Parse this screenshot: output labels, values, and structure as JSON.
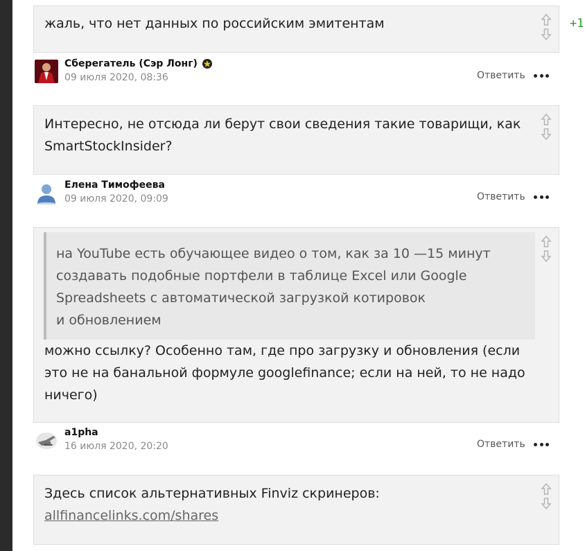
{
  "score": "+1",
  "comments": [
    {
      "text": "жаль, что нет данных по российским эмитентам"
    },
    {
      "text": "Интересно, не отсюда ли берут свои сведения такие товарищи, как SmartStockInsider?"
    },
    {
      "quote": [
        "на YouTube есть обучающее видео о том, как за 10 —15 минут",
        "создавать подобные портфели в таблице Excel или Google",
        "Spreadsheets с автоматической загрузкой котировок",
        "и обновлением"
      ],
      "text": "можно ссылку? Особенно там, где про загрузку и обновления (если это не на банальной формуле googlefinance; если на ней, то не надо ничего)"
    },
    {
      "text": "Здесь список альтернативных Finviz скринеров:",
      "link": "allfinancelinks.com/shares"
    }
  ],
  "authors": [
    {
      "name": "Сберегатель (Сэр Лонг)",
      "date": "09 июля 2020, 08:36",
      "reply": "Ответить",
      "avatar_icon": "red-suit-avatar",
      "has_star": true
    },
    {
      "name": "Елена Тимофеева",
      "date": "09 июля 2020, 09:09",
      "reply": "Ответить",
      "avatar_icon": "default-user-avatar",
      "has_star": false
    },
    {
      "name": "a1pha",
      "date": "16 июля 2020, 20:20",
      "reply": "Ответить",
      "avatar_icon": "hand-pointing-avatar",
      "has_star": false
    }
  ],
  "colors": {
    "score": "#2a9d2a",
    "comment_bg": "#f2f2f2",
    "quote_bg": "#e8e8e8",
    "sidebar": "#2b2b2b"
  }
}
